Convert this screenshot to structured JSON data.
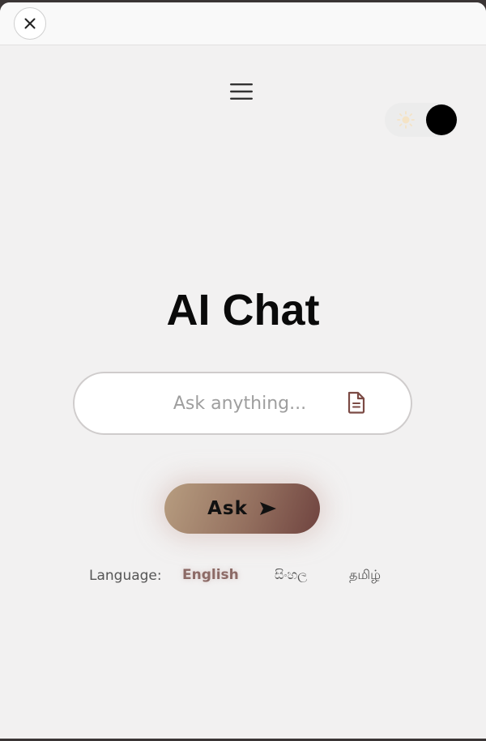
{
  "app": {
    "title": "AI Chat"
  },
  "top_bar": {
    "close_icon": "close-icon"
  },
  "header": {
    "menu_icon": "hamburger-menu-icon",
    "theme_toggle": {
      "sun_icon": "sun-icon",
      "state": "dark"
    }
  },
  "search": {
    "value": "",
    "placeholder": "Ask anything...",
    "document_icon": "document-icon"
  },
  "ask_button": {
    "label": "Ask",
    "icon": "send-arrow-icon"
  },
  "language": {
    "label": "Language:",
    "options": [
      "English",
      "සිංහල",
      "தமிழ்"
    ],
    "selected": "English"
  },
  "colors": {
    "background": "#f2f1f1",
    "accent": "#8c6a66",
    "button_gradient_start": "#b79d80",
    "button_gradient_end": "#6f433f"
  }
}
